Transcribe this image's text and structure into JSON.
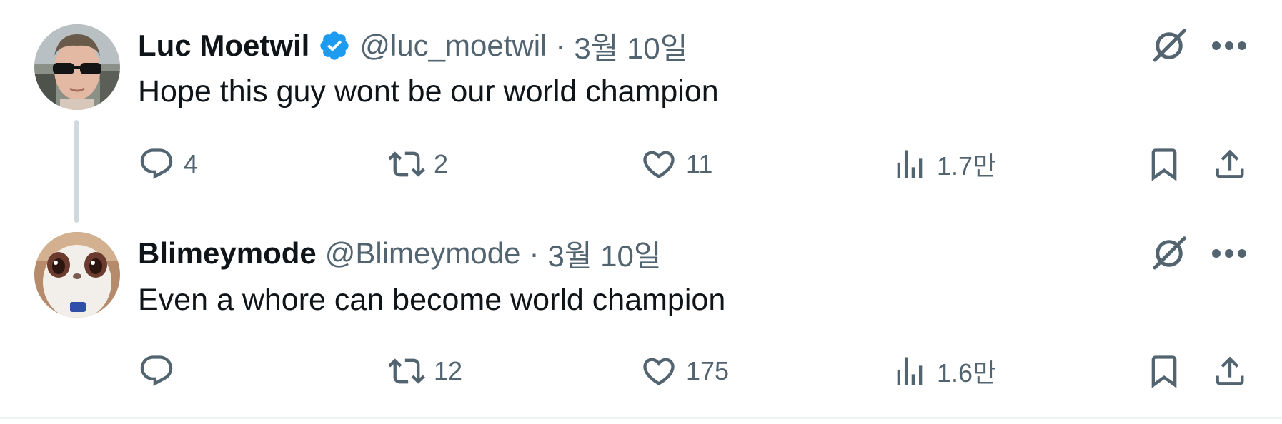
{
  "tweets": [
    {
      "author_name": "Luc Moetwil",
      "verified": true,
      "handle": "@luc_moetwil",
      "separator": "·",
      "date": "3월 10일",
      "text": "Hope this guy wont be our world champion",
      "replies": "4",
      "retweets": "2",
      "likes": "11",
      "views": "1.7만"
    },
    {
      "author_name": "Blimeymode",
      "verified": false,
      "handle": "@Blimeymode",
      "separator": "·",
      "date": "3월 10일",
      "text": "Even a whore can become world champion",
      "replies": "",
      "retweets": "12",
      "likes": "175",
      "views": "1.6만"
    }
  ],
  "colors": {
    "text_primary": "#0f1419",
    "text_secondary": "#536471",
    "verified_blue": "#1d9bf0",
    "thread_line": "#cfd9de"
  },
  "icons": [
    "reply-icon",
    "retweet-icon",
    "like-icon",
    "views-icon",
    "bookmark-icon",
    "share-icon",
    "grok-icon",
    "more-icon",
    "verified-badge-icon"
  ]
}
